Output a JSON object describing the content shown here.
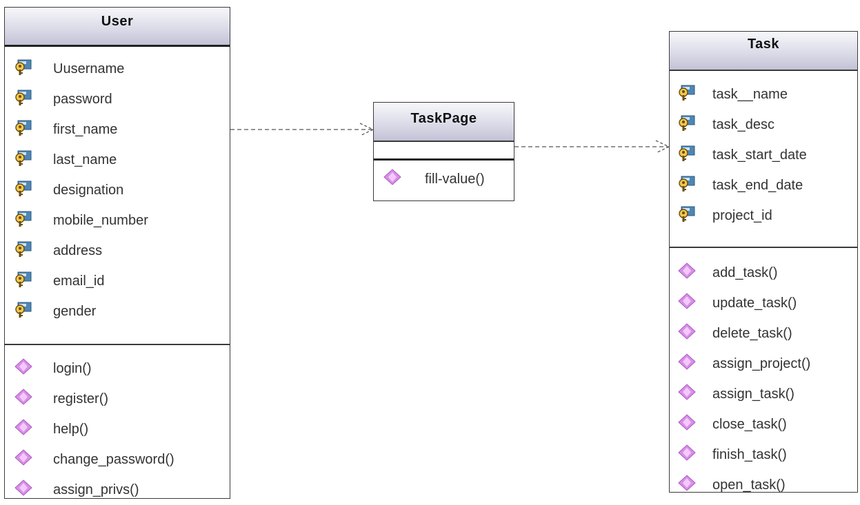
{
  "classes": {
    "user": {
      "name": "User",
      "attributes": [
        "Uusername",
        "password",
        "first_name",
        "last_name",
        "designation",
        "mobile_number",
        "address",
        "email_id",
        "gender"
      ],
      "operations": [
        "login()",
        "register()",
        "help()",
        "change_password()",
        "assign_privs()"
      ]
    },
    "taskpage": {
      "name": "TaskPage",
      "attributes": [],
      "operations": [
        "fill-value()"
      ]
    },
    "task": {
      "name": "Task",
      "attributes": [
        "task__name",
        "task_desc",
        "task_start_date",
        "task_end_date",
        "project_id"
      ],
      "operations": [
        "add_task()",
        "update_task()",
        "delete_task()",
        "assign_project()",
        "assign_task()",
        "close_task()",
        "finish_task()",
        "open_task()"
      ]
    }
  },
  "relations": [
    {
      "from": "User",
      "to": "TaskPage",
      "type": "dependency"
    },
    {
      "from": "TaskPage",
      "to": "Task",
      "type": "dependency"
    }
  ],
  "icons": {
    "attribute": "attribute-key-icon",
    "operation": "operation-diamond-icon"
  },
  "colors": {
    "header_top": "#f7f7fb",
    "header_bottom": "#c2c2d6",
    "operation_icon": "#d98ee8",
    "attribute_icon": "#4f86b4"
  }
}
